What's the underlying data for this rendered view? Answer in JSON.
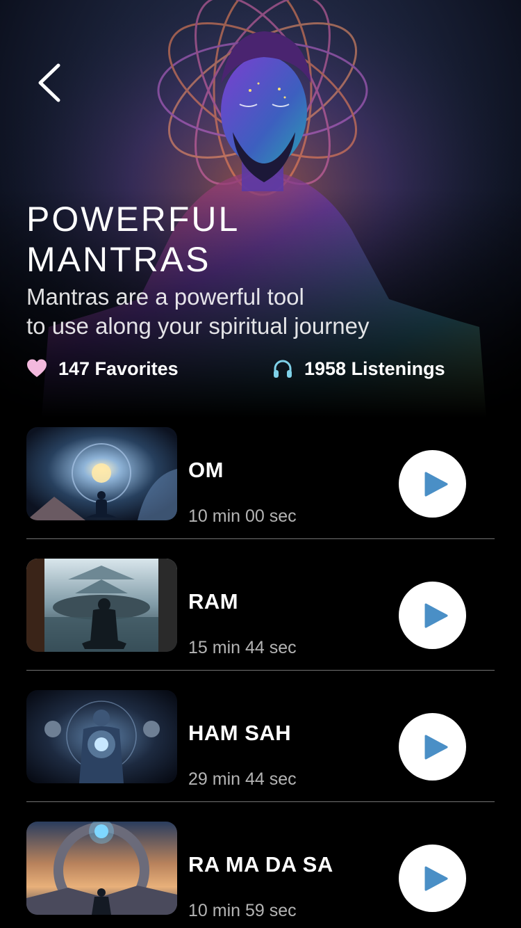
{
  "hero": {
    "title_line1": "POWERFUL",
    "title_line2": "MANTRAS",
    "description_line1": "Mantras are a powerful tool",
    "description_line2": "to use along your spiritual journey",
    "favorites_text": "147 Favorites",
    "listenings_text": "1958 Listenings",
    "back_icon": "chevron-left-icon",
    "favorites_icon": "heart-icon",
    "listenings_icon": "headphones-icon"
  },
  "mantras": [
    {
      "name": "OM",
      "duration": "10 min 00 sec",
      "thumbnail": "cosmic-orb-meditation"
    },
    {
      "name": "RAM",
      "duration": "15 min 44 sec",
      "thumbnail": "temple-lake-meditation"
    },
    {
      "name": "HAM SAH",
      "duration": "29 min 44 sec",
      "thumbnail": "glowing-figure-galaxy"
    },
    {
      "name": "RA MA DA SA",
      "duration": "10 min 59 sec",
      "thumbnail": "portal-sunset-meditation"
    }
  ],
  "colors": {
    "background": "#000000",
    "play_icon": "#4a8fc6",
    "heart": "#f3b9de",
    "headphones": "#7fd1e8"
  }
}
